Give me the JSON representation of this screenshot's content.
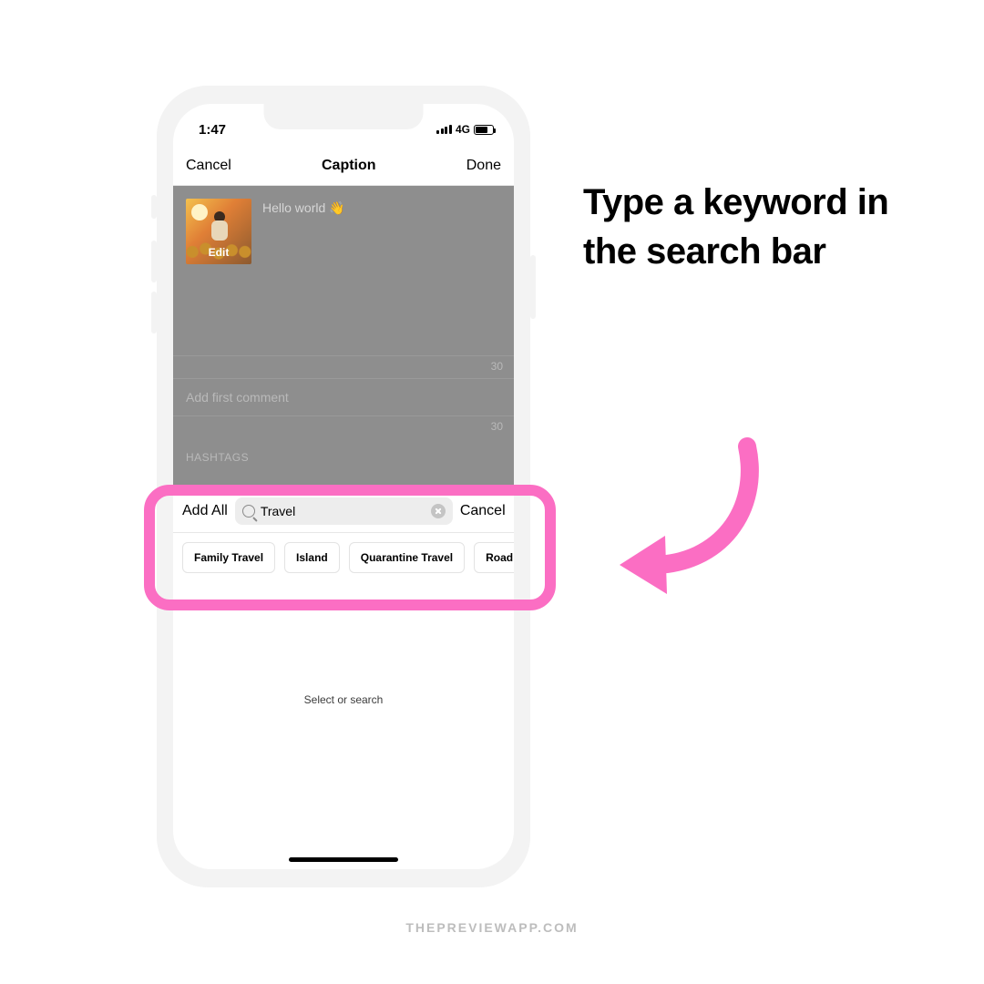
{
  "statusbar": {
    "time": "1:47",
    "network": "4G"
  },
  "nav": {
    "cancel": "Cancel",
    "title": "Caption",
    "done": "Done"
  },
  "caption": {
    "text": "Hello world 👋",
    "edit": "Edit"
  },
  "counters": {
    "captionLimit": "30",
    "commentLimit": "30"
  },
  "comment": {
    "placeholder": "Add first comment"
  },
  "hashtags": {
    "label": "HASHTAGS"
  },
  "search": {
    "addAll": "Add All",
    "value": "Travel",
    "cancel": "Cancel"
  },
  "chips": [
    "Family Travel",
    "Island",
    "Quarantine Travel",
    "Road T"
  ],
  "empty": "Select or search",
  "instruction": "Type a keyword in the search bar",
  "footer": "THEPREVIEWAPP.COM",
  "colors": {
    "accent": "#fb6ec3"
  }
}
